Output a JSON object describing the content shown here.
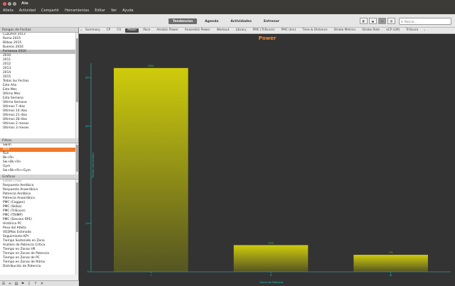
{
  "window": {
    "title": "Aie"
  },
  "menu": [
    "Atleta",
    "Actividad",
    "Compartir",
    "Herramientas",
    "Editar",
    "Ver",
    "Ayuda"
  ],
  "views": [
    {
      "label": "Tendencias",
      "active": true
    },
    {
      "label": "Agenda",
      "active": false
    },
    {
      "label": "Actividades",
      "active": false
    },
    {
      "label": "Entrenar",
      "active": false
    }
  ],
  "search": {
    "placeholder": "Buscar..."
  },
  "date_ranges": {
    "header": "Rangos de Fechas",
    "items": [
      "Cuzumel 2013",
      "Roma 2015",
      "Bilbao 2015",
      "Buenos 2016",
      "Fortaleza 2016",
      "2010",
      "2011",
      "2012",
      "2013",
      "2014",
      "2015",
      "Todas las Fechas",
      "Este Año",
      "Este Mes",
      "Último Mes",
      "Esta Semana",
      "Última Semana",
      "Últimos 7 días",
      "Últimos 14 días",
      "Últimos 21 días",
      "Últimos 28 días",
      "Últimos 2 meses",
      "Últimos 3 meses"
    ],
    "selected_index": 4
  },
  "filters": {
    "header": "Filtros",
    "items": [
      "Swim",
      "Bike",
      "Run",
      "Bk+Rn",
      "Sw+Bk+Rn",
      "Gym",
      "Sw+Bk+Rn+Gym"
    ],
    "highlight_index": 1
  },
  "charts": {
    "header": "Gráficos",
    "items": [
      "Estrés (TSS)",
      "Respuesta Aeróbica",
      "Respuesta Anaeróbica",
      "Potencia Aeróbica",
      "Potencia Anaeróbica",
      "PMC (Coggan)",
      "PMC (Skiba)",
      "PMC (TriScore)",
      "PMC (TRIMP)",
      "PMC (Session RPE)",
      "Histórico PC",
      "Peso del Atleta",
      "VO2Máx Estimado",
      "Seguimiento KPI",
      "Tiempo Sostenido en Zona",
      "Análisis de Potencia Crítica",
      "Tiempo en Zonas HR",
      "Tiempo en Zonas de Potencia",
      "Tiempo en Zonas de PC",
      "Tiempo en Zonas de Ritmo",
      "Distribución de Potencia"
    ],
    "group_index": 0
  },
  "chart_tabs": [
    {
      "label": "Summary",
      "active": false
    },
    {
      "label": "CP",
      "active": false
    },
    {
      "label": "CV",
      "active": false
    },
    {
      "label": "Power",
      "active": true
    },
    {
      "label": "Pace",
      "active": false
    },
    {
      "label": "Aerobic Power",
      "active": false
    },
    {
      "label": "Anaerobic Power",
      "active": false
    },
    {
      "label": "Workout",
      "active": false
    },
    {
      "label": "Library",
      "active": false
    },
    {
      "label": "PMC (TriScore)",
      "active": false
    },
    {
      "label": "PMC (km)",
      "active": false
    },
    {
      "label": "Time & Distance",
      "active": false
    },
    {
      "label": "Stroke Metrics",
      "active": false
    },
    {
      "label": "Stroke Rate",
      "active": false
    },
    {
      "label": "eCP (LM)",
      "active": false
    },
    {
      "label": "TriScore",
      "active": false
    }
  ],
  "colors": {
    "accent": "#f07a2b",
    "bar_top": "#cfcc0c",
    "bar_bottom": "#555522",
    "axis": "#2ec4c4",
    "chart_bg": "#333333",
    "title": "#f0883a"
  },
  "chart_data": {
    "type": "bar",
    "title": "Power",
    "xlabel": "Zona de Potencia",
    "ylabel": "Tiempo (porcentaje)",
    "categories": [
      "I",
      "II",
      "III"
    ],
    "values": [
      84,
      11,
      7
    ],
    "data_labels": [
      "84%",
      "11%",
      "7%"
    ],
    "ylim": [
      0,
      86
    ],
    "yticks": [
      0,
      20,
      60,
      80
    ],
    "grid": false
  }
}
